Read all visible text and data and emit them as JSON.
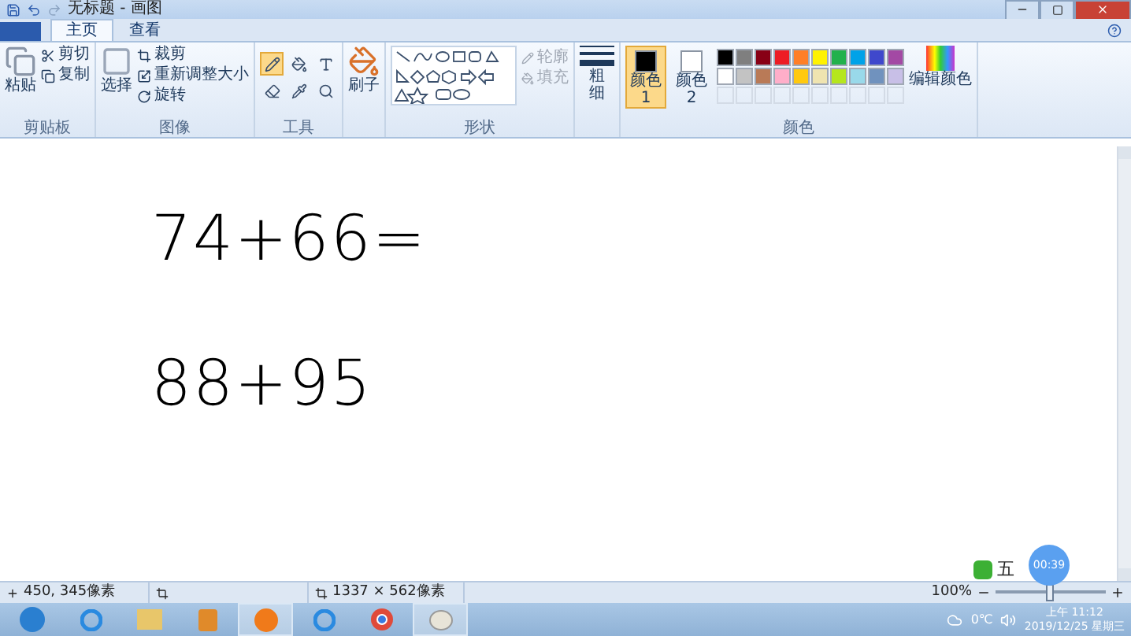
{
  "window": {
    "title": "无标题 - 画图"
  },
  "tabs": [
    {
      "label": "主页",
      "selected": true
    },
    {
      "label": "查看",
      "selected": false
    }
  ],
  "clipboard": {
    "paste": "粘贴",
    "cut": "剪切",
    "copy": "复制",
    "label": "剪贴板"
  },
  "image": {
    "select": "选择",
    "crop": "裁剪",
    "resize": "重新调整大小",
    "rotate": "旋转",
    "label": "图像"
  },
  "tools": {
    "label": "工具",
    "items": [
      {
        "kind": "pencil",
        "selected": true
      },
      {
        "kind": "fill",
        "selected": false
      },
      {
        "kind": "text",
        "selected": false
      },
      {
        "kind": "eraser",
        "selected": false
      },
      {
        "kind": "picker",
        "selected": false
      },
      {
        "kind": "magnifier",
        "selected": false
      }
    ]
  },
  "brushes": {
    "label": "刷子"
  },
  "shapes": {
    "label": "形状",
    "outline": {
      "label": "轮廓",
      "disabled": true
    },
    "fill": {
      "label": "填充",
      "disabled": true
    }
  },
  "size": {
    "label": "粗细"
  },
  "colors": {
    "label": "颜色",
    "edit": "编辑颜色",
    "slots": [
      {
        "label": "颜色 1",
        "color": "#000000",
        "selected": true
      },
      {
        "label": "颜色 2",
        "color": "#ffffff",
        "selected": false
      }
    ],
    "palette": [
      {
        "color": "#000000"
      },
      {
        "color": "#7f7f7f"
      },
      {
        "color": "#880015"
      },
      {
        "color": "#ed1c24"
      },
      {
        "color": "#ff7f27"
      },
      {
        "color": "#fff200"
      },
      {
        "color": "#22b14c"
      },
      {
        "color": "#00a2e8"
      },
      {
        "color": "#3f48cc"
      },
      {
        "color": "#a349a4"
      },
      {
        "color": "#ffffff"
      },
      {
        "color": "#c3c3c3"
      },
      {
        "color": "#b97a57"
      },
      {
        "color": "#ffaec9"
      },
      {
        "color": "#ffc90e"
      },
      {
        "color": "#efe4b0"
      },
      {
        "color": "#b5e61d"
      },
      {
        "color": "#99d9ea"
      },
      {
        "color": "#7092be"
      },
      {
        "color": "#c8bfe7"
      }
    ]
  },
  "canvas": {
    "lines": [
      "74+66=",
      "88+95"
    ]
  },
  "overlay": {
    "ime": "五",
    "timer": "00:39"
  },
  "status": {
    "cursor": "450, 345像素",
    "size": "1337 × 562像素",
    "zoom": "100%",
    "zoom_slider": {
      "level": 0.5
    }
  },
  "taskbar": {
    "temperature": "0℃",
    "time": "上午 11:12",
    "date": "2019/12/25 星期三"
  }
}
